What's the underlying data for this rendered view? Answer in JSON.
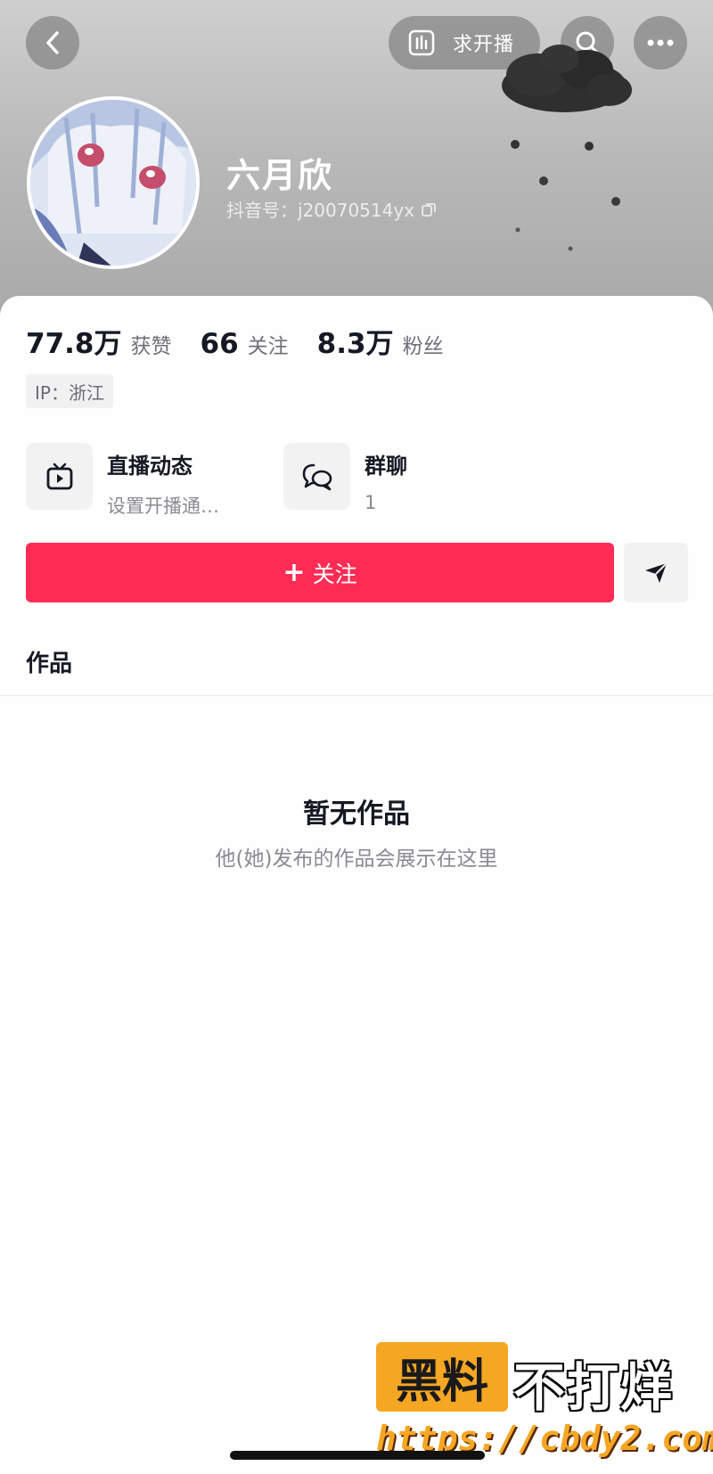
{
  "header": {
    "live_request_label": "求开播",
    "nickname": "六月欣",
    "douyin_id": "抖音号：j20070514yx"
  },
  "stats": [
    {
      "value": "77.8万",
      "label": "获赞"
    },
    {
      "value": "66",
      "label": "关注"
    },
    {
      "value": "8.3万",
      "label": "粉丝"
    }
  ],
  "ip": "IP：浙江",
  "entries": {
    "live": {
      "title": "直播动态",
      "subtitle": "设置开播通…"
    },
    "group": {
      "title": "群聊",
      "subtitle": "1"
    }
  },
  "actions": {
    "follow_label": "关注",
    "follow_plus": "+"
  },
  "tabs": {
    "works": "作品"
  },
  "empty": {
    "title": "暂无作品",
    "subtitle": "他(她)发布的作品会展示在这里"
  },
  "watermark": {
    "box_text": "黑料",
    "text": "不打烊",
    "url": "https://cbdy2.com"
  },
  "colors": {
    "accent": "#fe2c55",
    "watermark": "#f5a623"
  },
  "icons": [
    "back-icon",
    "bar-chart-icon",
    "search-icon",
    "more-icon",
    "copy-icon",
    "tv-icon",
    "chat-bubbles-icon",
    "send-icon"
  ]
}
